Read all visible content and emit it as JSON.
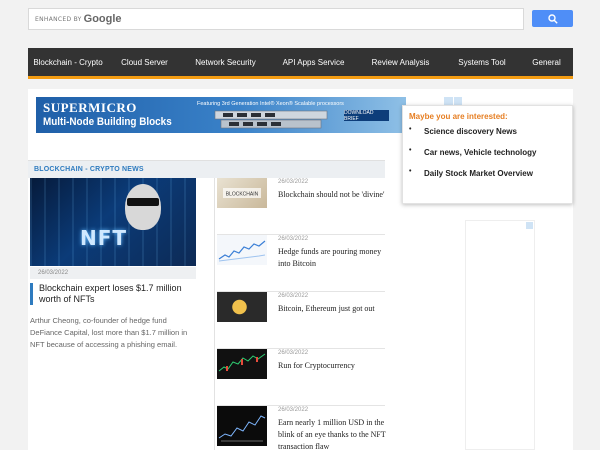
{
  "search": {
    "enhanced_label": "ENHANCED BY",
    "brand": "Google",
    "placeholder": ""
  },
  "nav": {
    "items": [
      {
        "label": "Blockchain - Crypto"
      },
      {
        "label": "Cloud Server"
      },
      {
        "label": "Network Security"
      },
      {
        "label": "API Apps Service"
      },
      {
        "label": "Review Analysis"
      },
      {
        "label": "Systems Tool"
      },
      {
        "label": "General"
      }
    ]
  },
  "ad": {
    "brand": "SUPERMICRO",
    "headline": "Multi-Node Building Blocks",
    "tagline": "Featuring 3rd Generation Intel® Xeon® Scalable processors",
    "cta": "DOWNLOAD BRIEF"
  },
  "popup": {
    "title": "Maybe you are interested:",
    "items": [
      {
        "bullet": "•",
        "label": "Science discovery News"
      },
      {
        "bullet": "•",
        "label": "Car news, Vehicle technology"
      },
      {
        "bullet": "•",
        "label": "Daily Stock Market Overview"
      }
    ]
  },
  "section": {
    "title": "BLOCKCHAIN - CRYPTO NEWS"
  },
  "featured": {
    "image_text": "NFT",
    "date": "26/03/2022",
    "title": "Blockchain expert loses $1.7 million worth of NFTs",
    "excerpt": "Arthur Cheong, co-founder of hedge fund DeFiance Capital, lost more than $1.7 million in NFT because of accessing a phishing email."
  },
  "list": [
    {
      "date": "26/03/2022",
      "title": "Blockchain should not be 'divine'",
      "thumb_text": "BLOCKCHAIN"
    },
    {
      "date": "26/03/2022",
      "title": "Hedge funds are pouring money into Bitcoin"
    },
    {
      "date": "26/03/2022",
      "title": "Bitcoin, Ethereum just got out"
    },
    {
      "date": "26/03/2022",
      "title": "Run for Cryptocurrency"
    },
    {
      "date": "26/03/2022",
      "title": "Earn nearly 1 million USD in the blink of an eye thanks to the NFT transaction flaw"
    }
  ],
  "colors": {
    "nav_bg": "#333333",
    "nav_accent": "#f39c12",
    "section_text": "#2e7bbf",
    "popup_title": "#e67e22",
    "search_button": "#4f8ef7"
  }
}
